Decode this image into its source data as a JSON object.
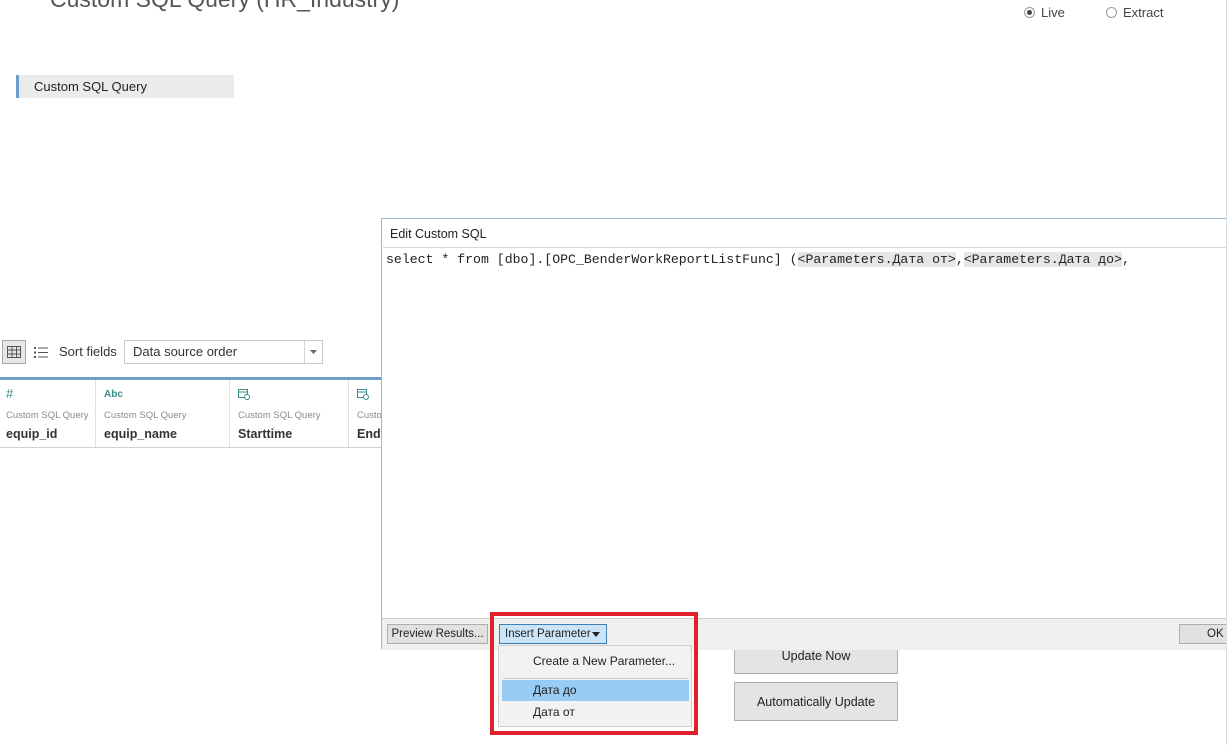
{
  "header": {
    "title": "Custom SQL Query (HR_Industry)",
    "connection_options": [
      {
        "label": "Live",
        "selected": true
      },
      {
        "label": "Extract",
        "selected": false
      }
    ]
  },
  "canvas": {
    "table_pill": "Custom SQL Query"
  },
  "toolbar": {
    "grid_icon": "grid-view-icon",
    "list_icon": "list-view-icon",
    "sort_label": "Sort fields",
    "sort_value": "Data source order"
  },
  "table": {
    "columns": [
      {
        "type_icon": "#",
        "source": "Custom SQL Query",
        "name": "equip_id"
      },
      {
        "type_icon": "Abc",
        "source": "Custom SQL Query",
        "name": "equip_name"
      },
      {
        "type_icon": "datetime-icon",
        "source": "Custom SQL Query",
        "name": "Starttime"
      },
      {
        "type_icon": "datetime-icon",
        "source": "Custom SQL Query",
        "name": "Endtime"
      }
    ]
  },
  "dialog": {
    "title": "Edit Custom SQL",
    "sql_prefix": "select * from [dbo].[OPC_BenderWorkReportListFunc] (",
    "param1": "<Parameters.Дата от>",
    "sep": ",",
    "param2": "<Parameters.Дата до>",
    "sql_suffix": ",",
    "preview_label": "Preview Results...",
    "insert_param_label": "Insert Parameter",
    "ok_label": "OK"
  },
  "background_buttons": {
    "update_now": "Update Now",
    "auto_update": "Automatically Update"
  },
  "menu": {
    "create": "Create a New Parameter...",
    "items": [
      "Дата до",
      "Дата от"
    ],
    "highlighted": "Дата до"
  },
  "colors": {
    "accent": "#6d9ec9",
    "highlight": "#99ccf5",
    "annotation": "#e0202a"
  }
}
